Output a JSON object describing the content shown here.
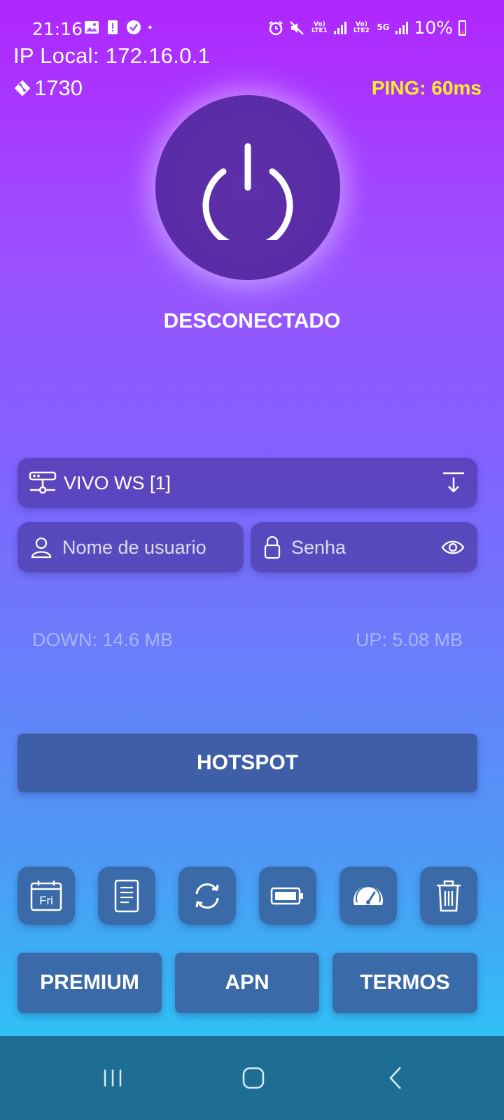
{
  "status_bar": {
    "time": "21:16",
    "battery": "10%",
    "sim1_label": "Vo) LTE1",
    "sim2_label": "Vo) LTE2",
    "net_label": "5G",
    "icons": [
      "gallery-icon",
      "alert-icon",
      "check-badge-icon",
      "dot-icon",
      "alarm-icon",
      "mute-icon",
      "signal-icon",
      "battery-icon"
    ]
  },
  "header": {
    "ip_local": "IP Local: 172.16.0.1",
    "port": "1730",
    "ping": "PING: 60ms"
  },
  "connection": {
    "status": "DESCONECTADO"
  },
  "form": {
    "server": "VIVO WS [1]",
    "username_placeholder": "Nome de usuario",
    "password_placeholder": "Senha"
  },
  "traffic": {
    "down": "DOWN: 14.6 MB",
    "up": "UP: 5.08 MB"
  },
  "buttons": {
    "hotspot": "HOTSPOT",
    "premium": "PREMIUM",
    "apn": "APN",
    "termos": "TERMOS",
    "calendar_day": "Fri"
  },
  "colors": {
    "ping": "#ffee22",
    "power_button": "#5a2aa6",
    "nav_bar": "#1e6e94"
  }
}
